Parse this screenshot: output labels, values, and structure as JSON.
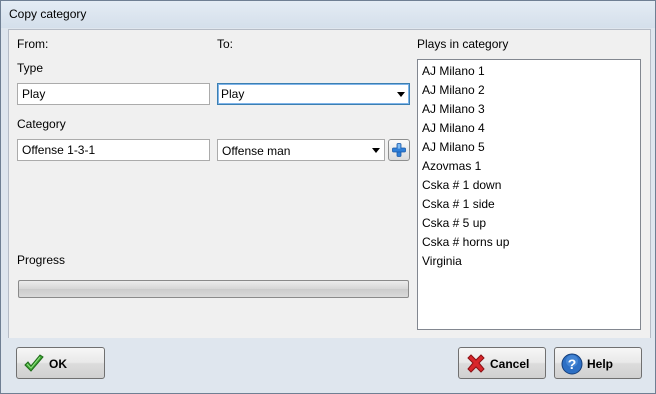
{
  "window": {
    "title": "Copy category"
  },
  "from": {
    "label": "From:",
    "type_label": "Type",
    "type_value": "Play",
    "category_label": "Category",
    "category_value": "Offense 1-3-1"
  },
  "to": {
    "label": "To:",
    "type_value": "Play",
    "category_value": "Offense man"
  },
  "plays": {
    "label": "Plays in category",
    "items": [
      "AJ Milano 1",
      "AJ Milano 2",
      "AJ Milano 3",
      "AJ Milano 4",
      "AJ Milano 5",
      "Azovmas 1",
      "Cska # 1 down",
      "Cska # 1 side",
      "Cska # 5 up",
      "Cska # horns up",
      "Virginia"
    ]
  },
  "progress": {
    "label": "Progress",
    "value": 0
  },
  "buttons": {
    "ok": "OK",
    "cancel": "Cancel",
    "help": "Help"
  },
  "icons": {
    "add": "plus-icon",
    "ok": "checkmark-icon",
    "cancel": "red-x-icon",
    "help": "question-mark-icon"
  }
}
